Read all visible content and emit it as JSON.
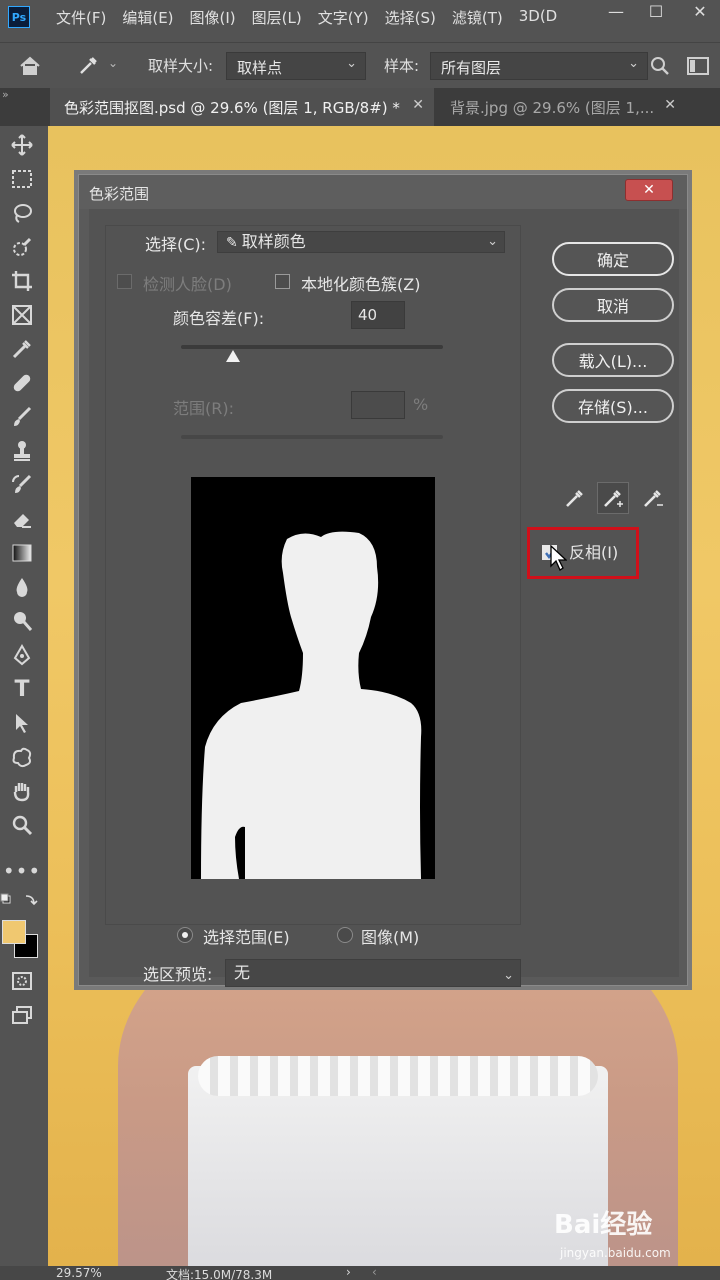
{
  "app": {
    "logo": "Ps"
  },
  "menubar": {
    "items": [
      "文件(F)",
      "编辑(E)",
      "图像(I)",
      "图层(L)",
      "文字(Y)",
      "选择(S)",
      "滤镜(T)",
      "3D(D"
    ]
  },
  "optionsbar": {
    "sample_size_label": "取样大小:",
    "sample_size_value": "取样点",
    "sample_label": "样本:",
    "sample_value": "所有图层"
  },
  "tabs": [
    {
      "label": "色彩范围抠图.psd @ 29.6% (图层 1, RGB/8#) *",
      "active": true
    },
    {
      "label": "背景.jpg @ 29.6% (图层 1,...",
      "active": false
    }
  ],
  "colors": {
    "foreground": "#f0c870",
    "background": "#000000",
    "highlight": "#d0101a"
  },
  "dialog": {
    "title": "色彩范围",
    "close": "✕",
    "select_label": "选择(C):",
    "select_value": "取样颜色",
    "detect_faces": "检测人脸(D)",
    "localized_clusters": "本地化颜色簇(Z)",
    "fuzziness_label": "颜色容差(F):",
    "fuzziness_value": "40",
    "range_label": "范围(R):",
    "range_unit": "%",
    "ok": "确定",
    "cancel": "取消",
    "load": "载入(L)...",
    "save": "存储(S)...",
    "invert": "反相(I)",
    "invert_checked": true,
    "radio_selection": "选择范围(E)",
    "radio_image": "图像(M)",
    "preview_label": "选区预览:",
    "preview_value": "无"
  },
  "statusbar": {
    "zoom": "29.57%",
    "doc": "文档:15.0M/78.3M"
  },
  "watermark": {
    "brand": "Bai经验",
    "site": "jingyan.baidu.com"
  }
}
